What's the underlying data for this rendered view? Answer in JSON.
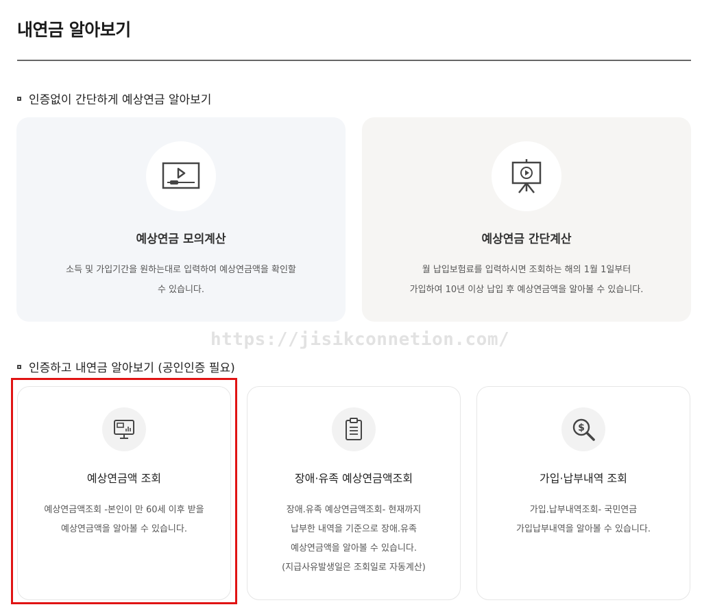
{
  "page": {
    "title": "내연금 알아보기"
  },
  "watermark": "https://jisikconnetion.com/",
  "section_simple": {
    "heading": "인증없이 간단하게 예상연금 알아보기",
    "cards": [
      {
        "icon": "video-play-icon",
        "title": "예상연금 모의계산",
        "description": "소득 및 가입기간을 원하는대로 입력하여 예상연금액을 확인할\n수 있습니다."
      },
      {
        "icon": "presentation-board-icon",
        "title": "예상연금 간단계산",
        "description": "월 납입보험료를 입력하시면 조회하는 해의 1월 1일부터\n가입하여 10년 이상 납입 후 예상연금액을 알아볼 수 있습니다."
      }
    ]
  },
  "section_auth": {
    "heading": "인증하고 내연금 알아보기 (공인인증 필요)",
    "cards": [
      {
        "icon": "monitor-chart-icon",
        "title": "예상연금액 조회",
        "description": "예상연금액조회 -본인이 만 60세 이후 받을\n예상연금액을 알아볼 수 있습니다."
      },
      {
        "icon": "clipboard-icon",
        "title": "장애·유족 예상연금액조회",
        "description": "장애.유족 예상연금액조회- 현재까지\n납부한 내역을 기준으로 장애.유족\n예상연금액을 알아볼 수 있습니다.\n(지급사유발생일은 조회일로 자동계산)"
      },
      {
        "icon": "dollar-magnifier-icon",
        "title": "가입·납부내역 조회",
        "description": "가입.납부내역조회- 국민연금\n가입납부내역을 알아볼 수 있습니다."
      }
    ]
  },
  "colors": {
    "highlight": "#e01313",
    "card_bg_cool": "#f4f6f9",
    "card_bg_warm": "#f6f5f3"
  }
}
